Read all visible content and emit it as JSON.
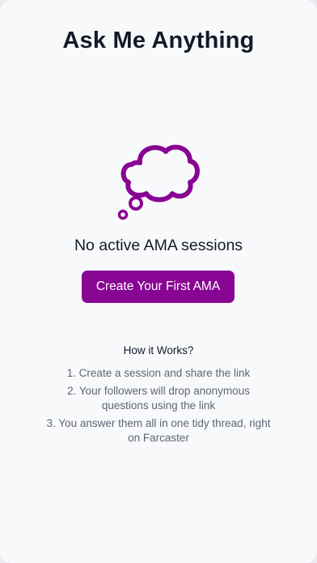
{
  "page": {
    "title": "Ask Me Anything"
  },
  "empty_state": {
    "icon": "thought-bubble-icon",
    "message": "No active AMA sessions",
    "cta_label": "Create Your First AMA"
  },
  "how_it_works": {
    "title": "How it Works?",
    "steps": [
      "1. Create a session and share the link",
      "2. Your followers will drop anonymous questions using the link",
      "3. You answer them all in one tidy thread, right on Farcaster"
    ]
  },
  "colors": {
    "accent": "#880593",
    "background": "#f8f9fb",
    "text_primary": "#151a29",
    "text_secondary": "#5f6574"
  }
}
